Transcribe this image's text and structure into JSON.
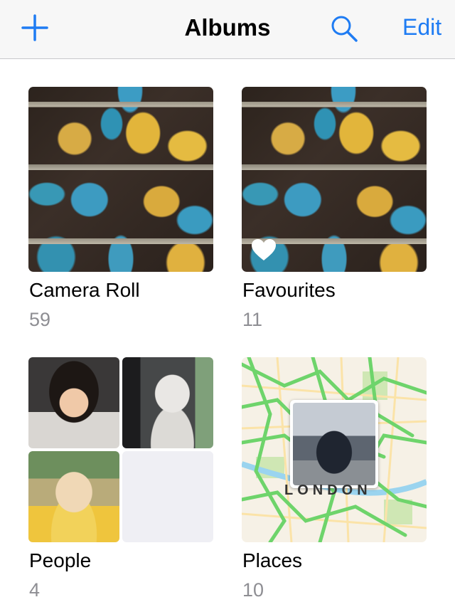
{
  "nav": {
    "title": "Albums",
    "edit_label": "Edit",
    "add_icon": "plus-icon",
    "search_icon": "search-icon",
    "accent_color": "#1f7cf3"
  },
  "albums": [
    {
      "name": "Camera Roll",
      "count": "59"
    },
    {
      "name": "Favourites",
      "count": "11"
    },
    {
      "name": "People",
      "count": "4"
    },
    {
      "name": "Places",
      "count": "10"
    }
  ],
  "map": {
    "label": "LONDON"
  }
}
